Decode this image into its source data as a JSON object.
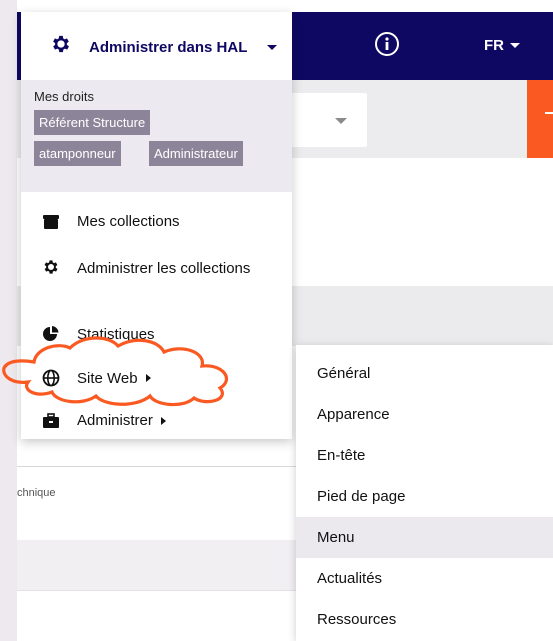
{
  "topbar": {
    "admin_label": "Administrer dans HAL",
    "language": "FR"
  },
  "rights": {
    "title": "Mes droits",
    "roles": [
      "Référent Structure",
      "atamponneur",
      "Administrateur"
    ]
  },
  "menu": {
    "items": [
      {
        "label": "Mes collections",
        "icon": "folder-icon"
      },
      {
        "label": "Administrer les collections",
        "icon": "gear-icon"
      },
      {
        "label": "Statistiques",
        "icon": "pie-chart-icon"
      },
      {
        "label": "Site Web",
        "icon": "globe-icon"
      },
      {
        "label": "Administrer",
        "icon": "toolbox-icon"
      }
    ]
  },
  "submenu": {
    "items": [
      "Général",
      "Apparence",
      "En-tête",
      "Pied de page",
      "Menu",
      "Actualités",
      "Ressources"
    ],
    "active": "Menu"
  },
  "background": {
    "technique_text": "chnique"
  },
  "colors": {
    "navy": "#0e0863",
    "orange": "#fa5a22",
    "badge": "#8c859a",
    "highlight": "#fa5a22"
  }
}
